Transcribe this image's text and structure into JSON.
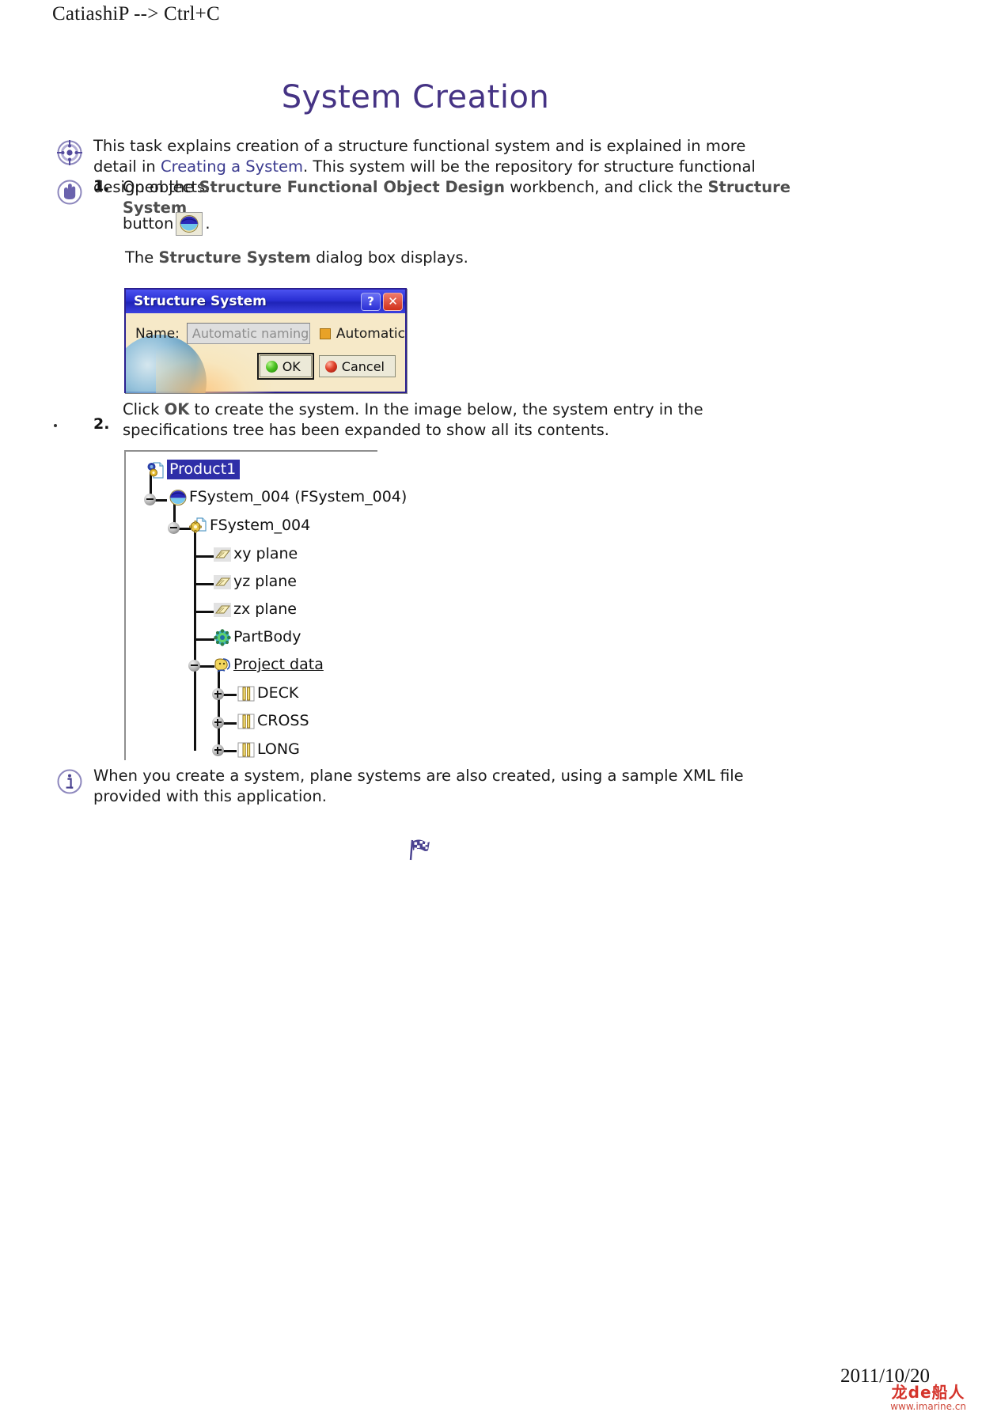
{
  "header": {
    "breadcrumb": "CatiashiP --> Ctrl+C"
  },
  "title": "System Creation",
  "intro": {
    "line1": "This task explains creation of a structure functional system and is explained in more detail in",
    "link": "Creating a System",
    "line2": ". This system will be the repository for structure functional design objects.",
    "icon": "target-icon"
  },
  "steps": [
    {
      "number": "1.",
      "icon": "hand-icon",
      "text_a": "Open the ",
      "bold_a": "Structure Functional Object Design",
      "text_b": " workbench, and click the ",
      "bold_b": "Structure System",
      "text_c": "",
      "cont_a": "button",
      "cont_b": ".",
      "button_icon": "structure-system-icon"
    },
    {
      "number": "2.",
      "text_a": "Click ",
      "bold_a": "OK",
      "text_b": " to create the system. In the image below, the system entry in the specifications tree has been expanded to show all its contents."
    }
  ],
  "dialog_lead": {
    "text_a": "The ",
    "bold_a": "Structure System",
    "text_b": " dialog box displays."
  },
  "dialog": {
    "title": "Structure System",
    "help_button": "?",
    "close_button": "✕",
    "name_label": "Name:",
    "name_placeholder": "Automatic naming",
    "name_value": "",
    "automatic_label": "Automatic",
    "automatic_checked": true,
    "ok_label": "OK",
    "cancel_label": "Cancel"
  },
  "tree": {
    "nodes": [
      {
        "label": "Product1",
        "icon": "product-icon",
        "selected": true,
        "underline": false,
        "toggle": "none",
        "depth": 0
      },
      {
        "label": "FSystem_004 (FSystem_004)",
        "icon": "fsystem-icon",
        "selected": false,
        "underline": false,
        "toggle": "minus",
        "depth": 1
      },
      {
        "label": "FSystem_004",
        "icon": "gear-doc-icon",
        "selected": false,
        "underline": false,
        "toggle": "minus",
        "depth": 2
      },
      {
        "label": "xy plane",
        "icon": "plane-icon",
        "selected": false,
        "underline": false,
        "toggle": "none",
        "depth": 3
      },
      {
        "label": "yz plane",
        "icon": "plane-icon",
        "selected": false,
        "underline": false,
        "toggle": "none",
        "depth": 3
      },
      {
        "label": "zx plane",
        "icon": "plane-icon",
        "selected": false,
        "underline": false,
        "toggle": "none",
        "depth": 3
      },
      {
        "label": "PartBody",
        "icon": "partbody-icon",
        "selected": false,
        "underline": false,
        "toggle": "none",
        "depth": 3
      },
      {
        "label": "Project data",
        "icon": "projdata-icon",
        "selected": false,
        "underline": true,
        "toggle": "minus",
        "depth": 3
      },
      {
        "label": "DECK",
        "icon": "beam-icon",
        "selected": false,
        "underline": false,
        "toggle": "plus",
        "depth": 4
      },
      {
        "label": "CROSS",
        "icon": "beam-icon",
        "selected": false,
        "underline": false,
        "toggle": "plus",
        "depth": 4
      },
      {
        "label": "LONG",
        "icon": "beam-icon",
        "selected": false,
        "underline": false,
        "toggle": "plus",
        "depth": 4
      }
    ]
  },
  "note": {
    "icon": "info-icon",
    "text": "When you create a system, plane systems are also created, using a sample XML file provided with this application."
  },
  "end_marker_icon": "checkered-flag-icon",
  "footer": {
    "date": "2011/10/20",
    "watermark_cn": "龙de船人",
    "watermark_url": "www.imarine.cn"
  },
  "colors": {
    "title": "#453384",
    "link": "#3b3b8f",
    "dialog_titlebar": "#2a2fd4",
    "dialog_body": "#f6e9c8",
    "selection": "#2f2fa8",
    "watermark": "#d4332a"
  }
}
